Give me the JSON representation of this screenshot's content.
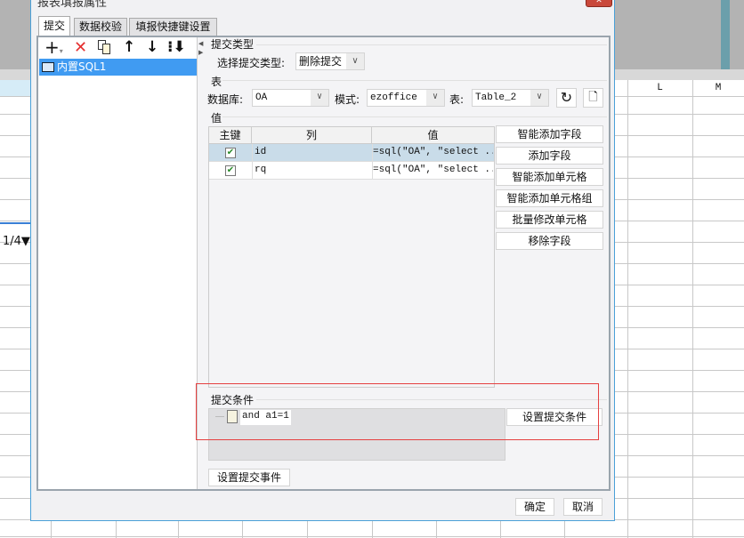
{
  "window": {
    "title": "报表填报属性"
  },
  "sheet": {
    "columns": [
      "L",
      "M"
    ],
    "page_indicator": "1/4▼"
  },
  "tabs": [
    {
      "label": "提交"
    },
    {
      "label": "数据校验"
    },
    {
      "label": "填报快捷键设置"
    }
  ],
  "left": {
    "items": [
      {
        "label": "内置SQL1"
      }
    ]
  },
  "submit_type": {
    "section": "提交类型",
    "label": "选择提交类型:",
    "value": "删除提交"
  },
  "table_section": {
    "section": "表",
    "db_label": "数据库:",
    "db_value": "OA",
    "schema_label": "模式:",
    "schema_value": "ezoffice",
    "table_label": "表:",
    "table_value": "Table_2"
  },
  "values": {
    "section": "值",
    "headers": [
      "主键",
      "列",
      "值"
    ],
    "rows": [
      {
        "key": true,
        "column": "id",
        "value": "=sql(\"OA\", \"select ..."
      },
      {
        "key": true,
        "column": "rq",
        "value": "=sql(\"OA\", \"select ..."
      }
    ],
    "buttons": [
      "智能添加字段",
      "添加字段",
      "智能添加单元格",
      "智能添加单元格组",
      "批量修改单元格",
      "移除字段"
    ]
  },
  "condition": {
    "section": "提交条件",
    "item": "and a1=1",
    "button": "设置提交条件"
  },
  "event_button": "设置提交事件",
  "footer": {
    "ok": "确定",
    "cancel": "取消"
  }
}
